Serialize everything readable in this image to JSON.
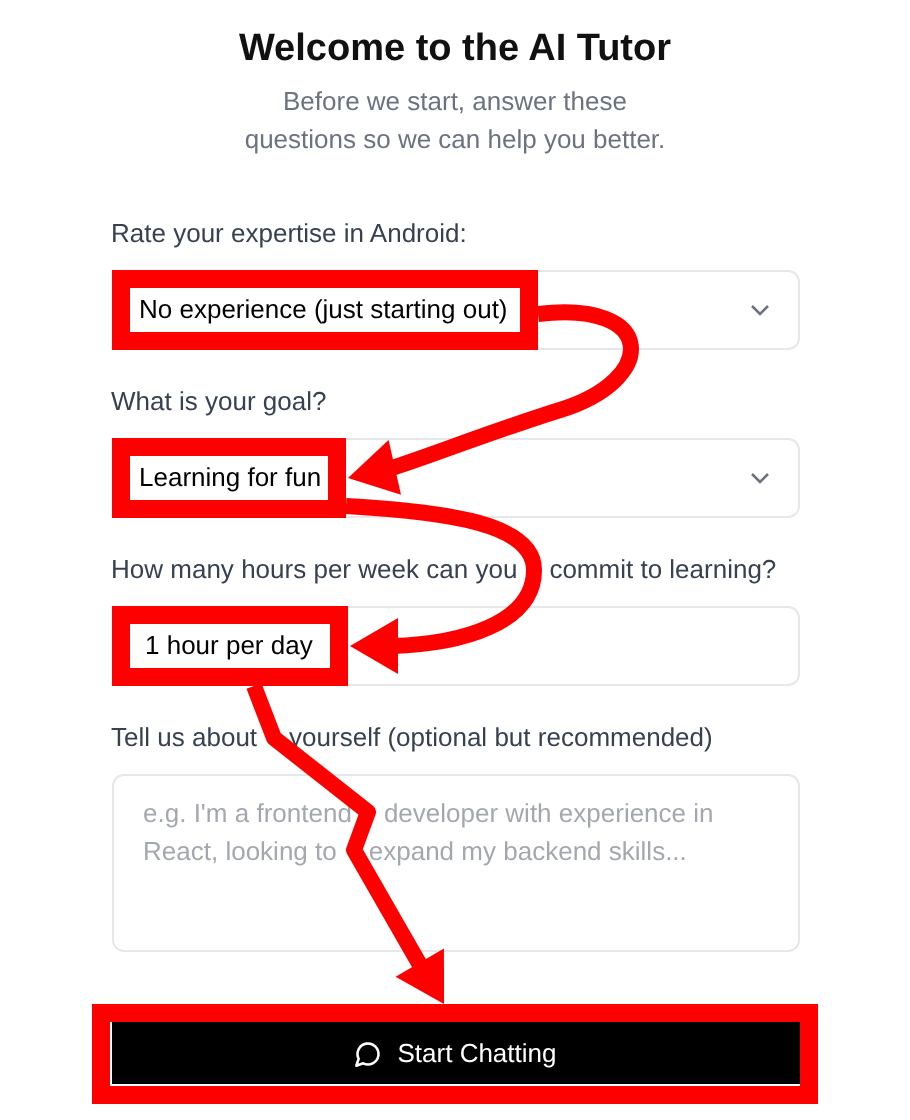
{
  "title": "Welcome to the AI Tutor",
  "subtitle": "Before we start, answer these questions so we can help you better.",
  "questions": [
    {
      "kind": "select",
      "label": "Rate your expertise in Android:",
      "value": "No experience (just starting out)",
      "highlighted": true
    },
    {
      "kind": "select",
      "label": "What is your goal?",
      "value": "Learning for fun",
      "highlighted": true
    },
    {
      "kind": "input",
      "label": "How many hours per week can you commit to learning?",
      "value": "1 hour per day",
      "highlighted": true
    },
    {
      "kind": "textarea",
      "label": "Tell us about yourself (optional but recommended)",
      "placeholder": "e.g. I'm a frontend developer with experience in React, looking to expand my backend skills..."
    }
  ],
  "button": {
    "label": "Start Chatting",
    "highlighted": true
  }
}
